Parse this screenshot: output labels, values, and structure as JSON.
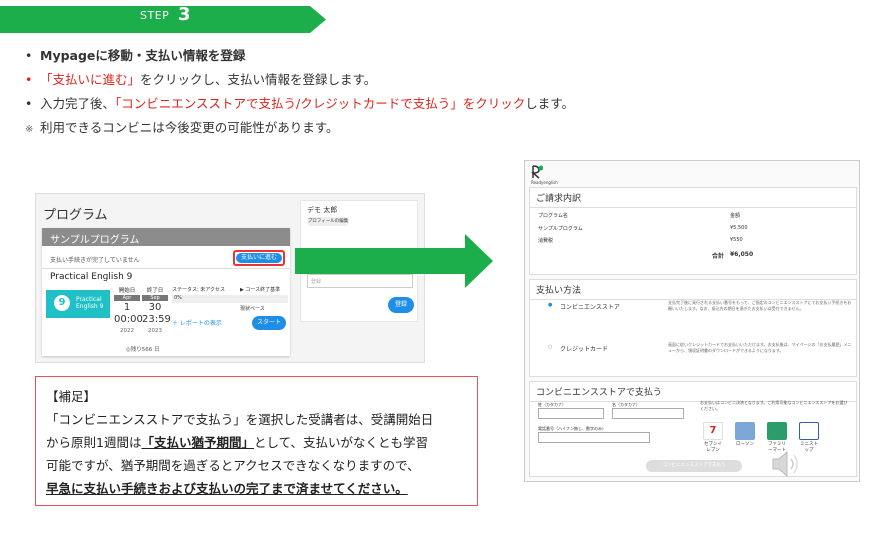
{
  "step": {
    "label": "STEP",
    "number": "3"
  },
  "bullets": [
    {
      "mark": "•",
      "parts": [
        {
          "t": "Mypageに移動・支払い情報を登録",
          "c": "bold"
        }
      ]
    },
    {
      "mark": "•",
      "mark_red": true,
      "parts": [
        {
          "t": "「支払いに進む」",
          "c": "red"
        },
        {
          "t": "をクリックし、支払い情報を登録します。",
          "c": ""
        }
      ]
    },
    {
      "mark": "•",
      "parts": [
        {
          "t": "入力完了後、",
          "c": ""
        },
        {
          "t": "「コンビニエンスストアで支払う/クレジットカードで支払う」をクリック",
          "c": "red"
        },
        {
          "t": "します。",
          "c": ""
        }
      ]
    },
    {
      "mark": "※",
      "parts": [
        {
          "t": "利用できるコンビニは今後変更の可能性があります。",
          "c": ""
        }
      ]
    }
  ],
  "app": {
    "page_title": "プログラム",
    "card_title": "サンプルプログラム",
    "note": "支払い手続きが完了していません",
    "pay_button": "支払いに進む",
    "course_name": "Practical English  9",
    "logo_text": "Practical English 9",
    "logo_mark": "9",
    "start": {
      "label": "開始日",
      "month": "Apr",
      "day": "1",
      "time": "00:00",
      "year": "2022"
    },
    "end": {
      "label": "終了日",
      "month": "Sep",
      "day": "30",
      "time": "23:59",
      "year": "2023"
    },
    "status": "ステータス: 未アクセス",
    "progress_pct": "0%",
    "goal": "▶ コース終了基準",
    "current": "現状ペース",
    "report_link": "＋ レポートの表示",
    "start_button": "スタート",
    "remaining": "◎残り566 日",
    "user_name": "デモ 太郎",
    "profile_button": "プロフィールの編集",
    "input_placeholder": "登録",
    "login_button": "登録"
  },
  "supplement": {
    "heading": "【補足】",
    "line1": "「コンビニエンスストアで支払う」を選択した受講者は、受講開始日",
    "line2a": "から原則1週間は",
    "line2b": "「支払い猶予期間」",
    "line2c": "として、支払いがなくとも学習",
    "line3": "可能ですが、猶予期間を過ぎるとアクセスできなくなりますので、",
    "line4": "早急に支払い手続きおよび支払いの完了まで済ませてください。"
  },
  "pay": {
    "brand": "Readyenglish",
    "invoice_title": "ご請求内訳",
    "col_name": "プログラム名",
    "col_amount": "金額",
    "item1": "サンプルプログラム",
    "item1_amount": "¥5,500",
    "item2": "消費税",
    "item2_amount": "¥550",
    "total_label": "合計",
    "total": "¥6,050",
    "method_title": "支払い方法",
    "method_conv": "コンビニエンスストア",
    "method_card": "クレジットカード",
    "conv_desc": "支払完了後に発行される支払い番号をもって、ご指定のコンビニエンスストアにてお支払い手続きをお願いいたします。なお、振込先の期日を過ぎたお支払いは受付できません。",
    "card_desc": "画面に従いクレジットカードでお支払いいただけます。お支払後は、マイページの「お支払履歴」メニューから、領収証明書のダウンロードができるようになります。",
    "conv_section_title": "コンビニエンスストアで支払う",
    "sei": "姓（カタカナ）",
    "mei": "名（カタカナ）",
    "phone": "電話番号（ハイフン無し、数字のみ）",
    "store_note": "お支払いはコンビニ決済となります。ご利用可能なコンビニエンスストアをお選びください。",
    "stores": [
      "セブンイレブン",
      "ローソン",
      "ファミリーマート",
      "ミニストップ"
    ],
    "submit": "コンビニエンスストアで支払う"
  }
}
